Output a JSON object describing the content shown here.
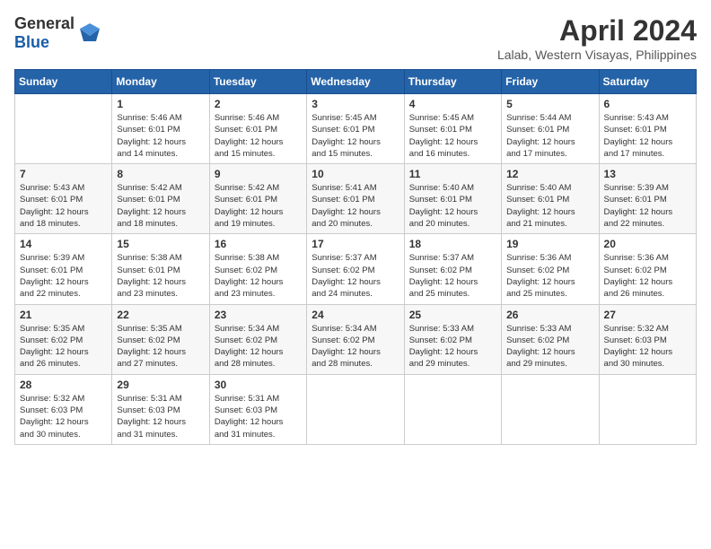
{
  "header": {
    "logo_general": "General",
    "logo_blue": "Blue",
    "month_title": "April 2024",
    "location": "Lalab, Western Visayas, Philippines"
  },
  "days_of_week": [
    "Sunday",
    "Monday",
    "Tuesday",
    "Wednesday",
    "Thursday",
    "Friday",
    "Saturday"
  ],
  "weeks": [
    [
      {
        "day": "",
        "info": ""
      },
      {
        "day": "1",
        "info": "Sunrise: 5:46 AM\nSunset: 6:01 PM\nDaylight: 12 hours\nand 14 minutes."
      },
      {
        "day": "2",
        "info": "Sunrise: 5:46 AM\nSunset: 6:01 PM\nDaylight: 12 hours\nand 15 minutes."
      },
      {
        "day": "3",
        "info": "Sunrise: 5:45 AM\nSunset: 6:01 PM\nDaylight: 12 hours\nand 15 minutes."
      },
      {
        "day": "4",
        "info": "Sunrise: 5:45 AM\nSunset: 6:01 PM\nDaylight: 12 hours\nand 16 minutes."
      },
      {
        "day": "5",
        "info": "Sunrise: 5:44 AM\nSunset: 6:01 PM\nDaylight: 12 hours\nand 17 minutes."
      },
      {
        "day": "6",
        "info": "Sunrise: 5:43 AM\nSunset: 6:01 PM\nDaylight: 12 hours\nand 17 minutes."
      }
    ],
    [
      {
        "day": "7",
        "info": "Sunrise: 5:43 AM\nSunset: 6:01 PM\nDaylight: 12 hours\nand 18 minutes."
      },
      {
        "day": "8",
        "info": "Sunrise: 5:42 AM\nSunset: 6:01 PM\nDaylight: 12 hours\nand 18 minutes."
      },
      {
        "day": "9",
        "info": "Sunrise: 5:42 AM\nSunset: 6:01 PM\nDaylight: 12 hours\nand 19 minutes."
      },
      {
        "day": "10",
        "info": "Sunrise: 5:41 AM\nSunset: 6:01 PM\nDaylight: 12 hours\nand 20 minutes."
      },
      {
        "day": "11",
        "info": "Sunrise: 5:40 AM\nSunset: 6:01 PM\nDaylight: 12 hours\nand 20 minutes."
      },
      {
        "day": "12",
        "info": "Sunrise: 5:40 AM\nSunset: 6:01 PM\nDaylight: 12 hours\nand 21 minutes."
      },
      {
        "day": "13",
        "info": "Sunrise: 5:39 AM\nSunset: 6:01 PM\nDaylight: 12 hours\nand 22 minutes."
      }
    ],
    [
      {
        "day": "14",
        "info": "Sunrise: 5:39 AM\nSunset: 6:01 PM\nDaylight: 12 hours\nand 22 minutes."
      },
      {
        "day": "15",
        "info": "Sunrise: 5:38 AM\nSunset: 6:01 PM\nDaylight: 12 hours\nand 23 minutes."
      },
      {
        "day": "16",
        "info": "Sunrise: 5:38 AM\nSunset: 6:02 PM\nDaylight: 12 hours\nand 23 minutes."
      },
      {
        "day": "17",
        "info": "Sunrise: 5:37 AM\nSunset: 6:02 PM\nDaylight: 12 hours\nand 24 minutes."
      },
      {
        "day": "18",
        "info": "Sunrise: 5:37 AM\nSunset: 6:02 PM\nDaylight: 12 hours\nand 25 minutes."
      },
      {
        "day": "19",
        "info": "Sunrise: 5:36 AM\nSunset: 6:02 PM\nDaylight: 12 hours\nand 25 minutes."
      },
      {
        "day": "20",
        "info": "Sunrise: 5:36 AM\nSunset: 6:02 PM\nDaylight: 12 hours\nand 26 minutes."
      }
    ],
    [
      {
        "day": "21",
        "info": "Sunrise: 5:35 AM\nSunset: 6:02 PM\nDaylight: 12 hours\nand 26 minutes."
      },
      {
        "day": "22",
        "info": "Sunrise: 5:35 AM\nSunset: 6:02 PM\nDaylight: 12 hours\nand 27 minutes."
      },
      {
        "day": "23",
        "info": "Sunrise: 5:34 AM\nSunset: 6:02 PM\nDaylight: 12 hours\nand 28 minutes."
      },
      {
        "day": "24",
        "info": "Sunrise: 5:34 AM\nSunset: 6:02 PM\nDaylight: 12 hours\nand 28 minutes."
      },
      {
        "day": "25",
        "info": "Sunrise: 5:33 AM\nSunset: 6:02 PM\nDaylight: 12 hours\nand 29 minutes."
      },
      {
        "day": "26",
        "info": "Sunrise: 5:33 AM\nSunset: 6:02 PM\nDaylight: 12 hours\nand 29 minutes."
      },
      {
        "day": "27",
        "info": "Sunrise: 5:32 AM\nSunset: 6:03 PM\nDaylight: 12 hours\nand 30 minutes."
      }
    ],
    [
      {
        "day": "28",
        "info": "Sunrise: 5:32 AM\nSunset: 6:03 PM\nDaylight: 12 hours\nand 30 minutes."
      },
      {
        "day": "29",
        "info": "Sunrise: 5:31 AM\nSunset: 6:03 PM\nDaylight: 12 hours\nand 31 minutes."
      },
      {
        "day": "30",
        "info": "Sunrise: 5:31 AM\nSunset: 6:03 PM\nDaylight: 12 hours\nand 31 minutes."
      },
      {
        "day": "",
        "info": ""
      },
      {
        "day": "",
        "info": ""
      },
      {
        "day": "",
        "info": ""
      },
      {
        "day": "",
        "info": ""
      }
    ]
  ]
}
